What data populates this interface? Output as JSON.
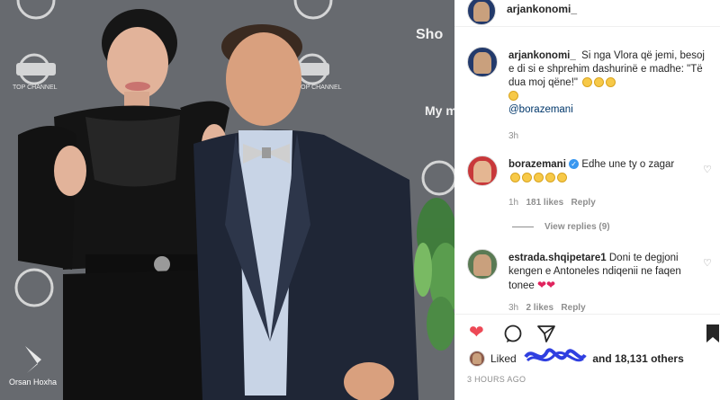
{
  "post": {
    "username": "arjankonomi_",
    "caption_text": "Si nga Vlora që jemi, besoj e di si e shprehim dashurinë e madhe: \"Të dua moj qëne!\"",
    "caption_mention": "@borazemani",
    "caption_time": "3h",
    "comments": [
      {
        "username": "borazemani",
        "text": "Edhe une ty o zagar",
        "time": "1h",
        "likes": "181 likes",
        "reply": "Reply",
        "view_replies": "View replies (9)"
      },
      {
        "username": "estrada.shqipetare1",
        "text": "Doni te degjoni kengen e Antoneles ndiqenii ne faqen tonee",
        "time": "3h",
        "likes": "2 likes",
        "reply": "Reply"
      }
    ],
    "liked_by_prefix": "Liked",
    "liked_by_suffix": "and 18,131 others",
    "time_ago": "3 HOURS AGO"
  },
  "photo": {
    "logos": [
      "TOP CHANNEL",
      "My music",
      "Sho"
    ],
    "watermark": "Orsan Hoxha"
  },
  "icons": {
    "like": "heart-filled-icon",
    "comment": "comment-icon",
    "share": "share-icon",
    "save": "bookmark-icon"
  },
  "colors": {
    "like_red": "#ed4956",
    "mention_blue": "#00376b",
    "verified_blue": "#3897f0",
    "scribble": "#2f3fe0"
  }
}
